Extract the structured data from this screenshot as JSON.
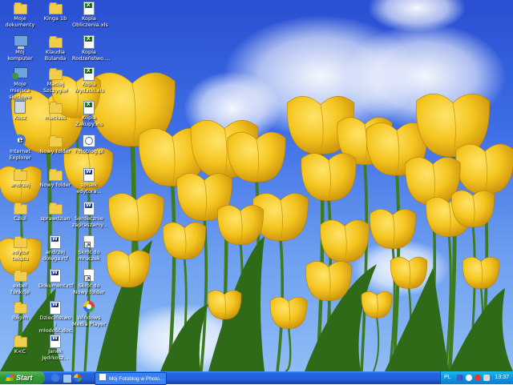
{
  "desktop": {
    "icons": [
      {
        "label": "Moje dokumenty",
        "type": "folder-docs"
      },
      {
        "label": "Kinga 1b",
        "type": "folder"
      },
      {
        "label": "Kopia Obliczenia.xls",
        "type": "xls"
      },
      {
        "label": "Mój komputer",
        "type": "computer"
      },
      {
        "label": "Klaudia Bulanda",
        "type": "folder"
      },
      {
        "label": "Kopia Rodzeństwo....",
        "type": "xls"
      },
      {
        "label": "Moje miejsca sieciowe",
        "type": "network"
      },
      {
        "label": "Maciej Szczygieł",
        "type": "folder"
      },
      {
        "label": "Kopia Wydatki.xls",
        "type": "xls"
      },
      {
        "label": "Kosz",
        "type": "bin"
      },
      {
        "label": "maciuss",
        "type": "folder"
      },
      {
        "label": "Kopia Zakupy.xls",
        "type": "xls"
      },
      {
        "label": "Internet Explorer",
        "type": "ie"
      },
      {
        "label": "Nowy folder",
        "type": "folder"
      },
      {
        "label": "Fotoblog.pl",
        "type": "fotoblog"
      },
      {
        "label": "andrzej",
        "type": "folder"
      },
      {
        "label": "Nowy folder",
        "type": "folder"
      },
      {
        "label": "spisek edytora...",
        "type": "doc"
      },
      {
        "label": "Cziul",
        "type": "folder"
      },
      {
        "label": "sprawdzian",
        "type": "folder"
      },
      {
        "label": "Serdecznie zapraszamy...",
        "type": "doc"
      },
      {
        "label": "edytor tekstu",
        "type": "folder"
      },
      {
        "label": "andrzej dołęga.rtf",
        "type": "doc"
      },
      {
        "label": "Skrót do mruczek",
        "type": "shortcut"
      },
      {
        "label": "exbel funkcje",
        "type": "folder"
      },
      {
        "label": "Dokument.rtf",
        "type": "doc"
      },
      {
        "label": "Skrót do Nowy folder",
        "type": "shortcut"
      },
      {
        "label": "Ibigim",
        "type": "folder"
      },
      {
        "label": "Dzieciństwo i młodość.doc",
        "type": "doc"
      },
      {
        "label": "Windows Media Player",
        "type": "wmp"
      },
      {
        "label": "K<C",
        "type": "folder"
      },
      {
        "label": "Janek Jędrkosz...",
        "type": "doc"
      }
    ]
  },
  "taskbar": {
    "start_label": "Start",
    "task_label": "Mój Fotoblog w Photo...",
    "lang": "PL",
    "clock": "13:37"
  },
  "colors": {
    "sky_top": "#2a4fd2",
    "taskbar": "#245edb",
    "start": "#379d37",
    "tulip": "#f2c520"
  }
}
